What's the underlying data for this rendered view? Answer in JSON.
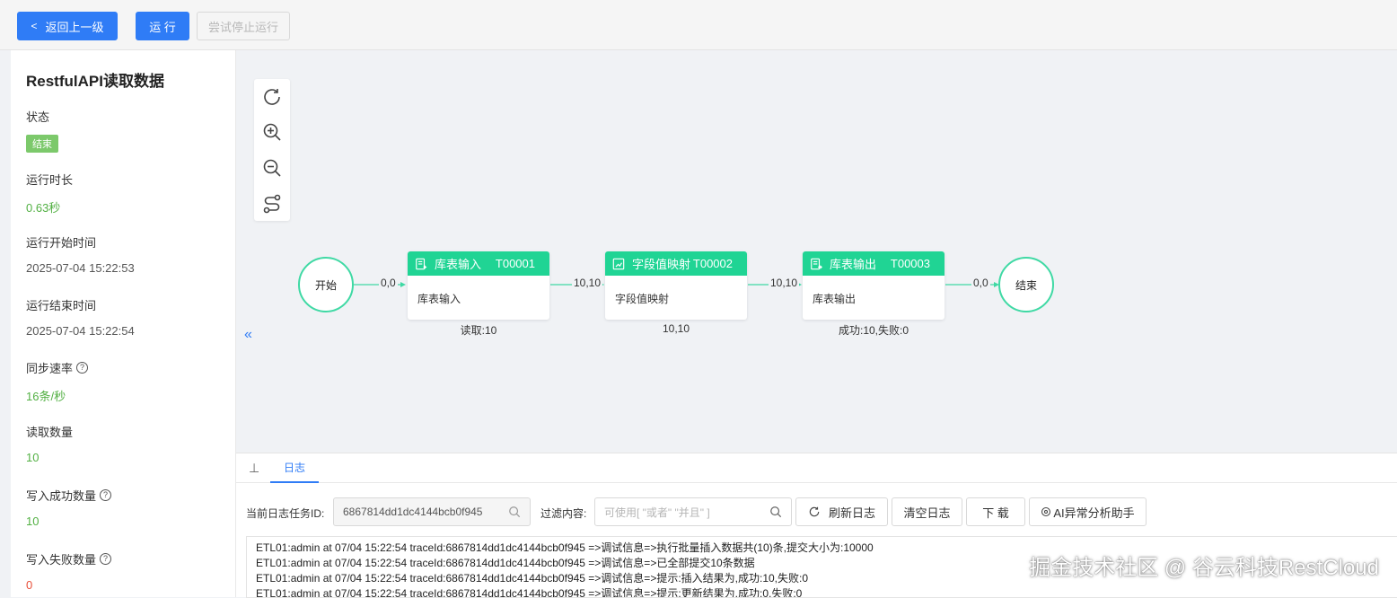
{
  "toolbar": {
    "back_label": "返回上一级",
    "run_label": "运 行",
    "stop_label": "尝试停止运行"
  },
  "sidebar": {
    "title": "RestfulAPI读取数据",
    "status_label": "状态",
    "status_value": "结束",
    "duration_label": "运行时长",
    "duration_value": "0.63秒",
    "start_label": "运行开始时间",
    "start_value": "2025-07-04 15:22:53",
    "end_label": "运行结束时间",
    "end_value": "2025-07-04 15:22:54",
    "rate_label": "同步速率",
    "rate_value": "16条/秒",
    "read_label": "读取数量",
    "read_value": "10",
    "write_ok_label": "写入成功数量",
    "write_ok_value": "10",
    "write_fail_label": "写入失败数量",
    "write_fail_value": "0"
  },
  "flow": {
    "start": "开始",
    "end": "结束",
    "nodes": [
      {
        "name": "库表输入",
        "code": "T00001",
        "body": "库表输入",
        "stat": "读取:10"
      },
      {
        "name": "字段值映射",
        "code": "T00002",
        "body": "字段值映射",
        "stat": "10,10"
      },
      {
        "name": "库表输出",
        "code": "T00003",
        "body": "库表输出",
        "stat": "成功:10,失败:0"
      }
    ],
    "edges": [
      "0,0",
      "10,10",
      "10,10",
      "0,0"
    ]
  },
  "log": {
    "tab_label": "日志",
    "task_label": "当前日志任务ID:",
    "task_value": "6867814dd1dc4144bcb0f945",
    "filter_label": "过滤内容:",
    "filter_placeholder": "可使用[ \"或者\"  \"并且\" ]",
    "refresh_label": "刷新日志",
    "clear_label": "清空日志",
    "download_label": "下 载",
    "ai_label": "AI异常分析助手",
    "lines": [
      "ETL01:admin at 07/04 15:22:54 traceId:6867814dd1dc4144bcb0f945 =>调试信息=>执行批量插入数据共(10)条,提交大小为:10000",
      "ETL01:admin at 07/04 15:22:54 traceId:6867814dd1dc4144bcb0f945 =>调试信息=>已全部提交10条数据",
      "ETL01:admin at 07/04 15:22:54 traceId:6867814dd1dc4144bcb0f945 =>调试信息=>提示:插入结果为,成功:10,失败:0",
      "ETL01:admin at 07/04 15:22:54 traceId:6867814dd1dc4144bcb0f945 =>调试信息=>提示:更新结果为,成功:0,失败:0"
    ]
  },
  "watermark": "掘金技术社区 @ 谷云科技RestCloud",
  "colors": {
    "primary": "#2f7cf6",
    "node_header": "#20d494",
    "node_border": "#3fd9a4",
    "success_text": "#52b043",
    "error_text": "#e8503a"
  }
}
